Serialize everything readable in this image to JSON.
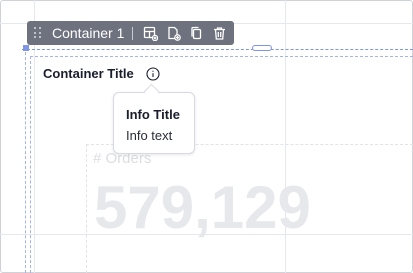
{
  "toolbar": {
    "title": "Container 1",
    "icons": [
      "drag-handle-icon",
      "add-component-icon",
      "add-page-icon",
      "duplicate-icon",
      "delete-icon"
    ]
  },
  "container": {
    "title": "Container Title",
    "info_icon": "info-icon"
  },
  "tooltip": {
    "title": "Info Title",
    "text": "Info text"
  },
  "metric": {
    "label": "# Orders",
    "value": "579,129"
  },
  "colors": {
    "toolbar_bg": "#6e727e",
    "selection": "#7f96e8",
    "title_text": "#1a1d2c",
    "metric_faded": "#e7e8ec"
  }
}
